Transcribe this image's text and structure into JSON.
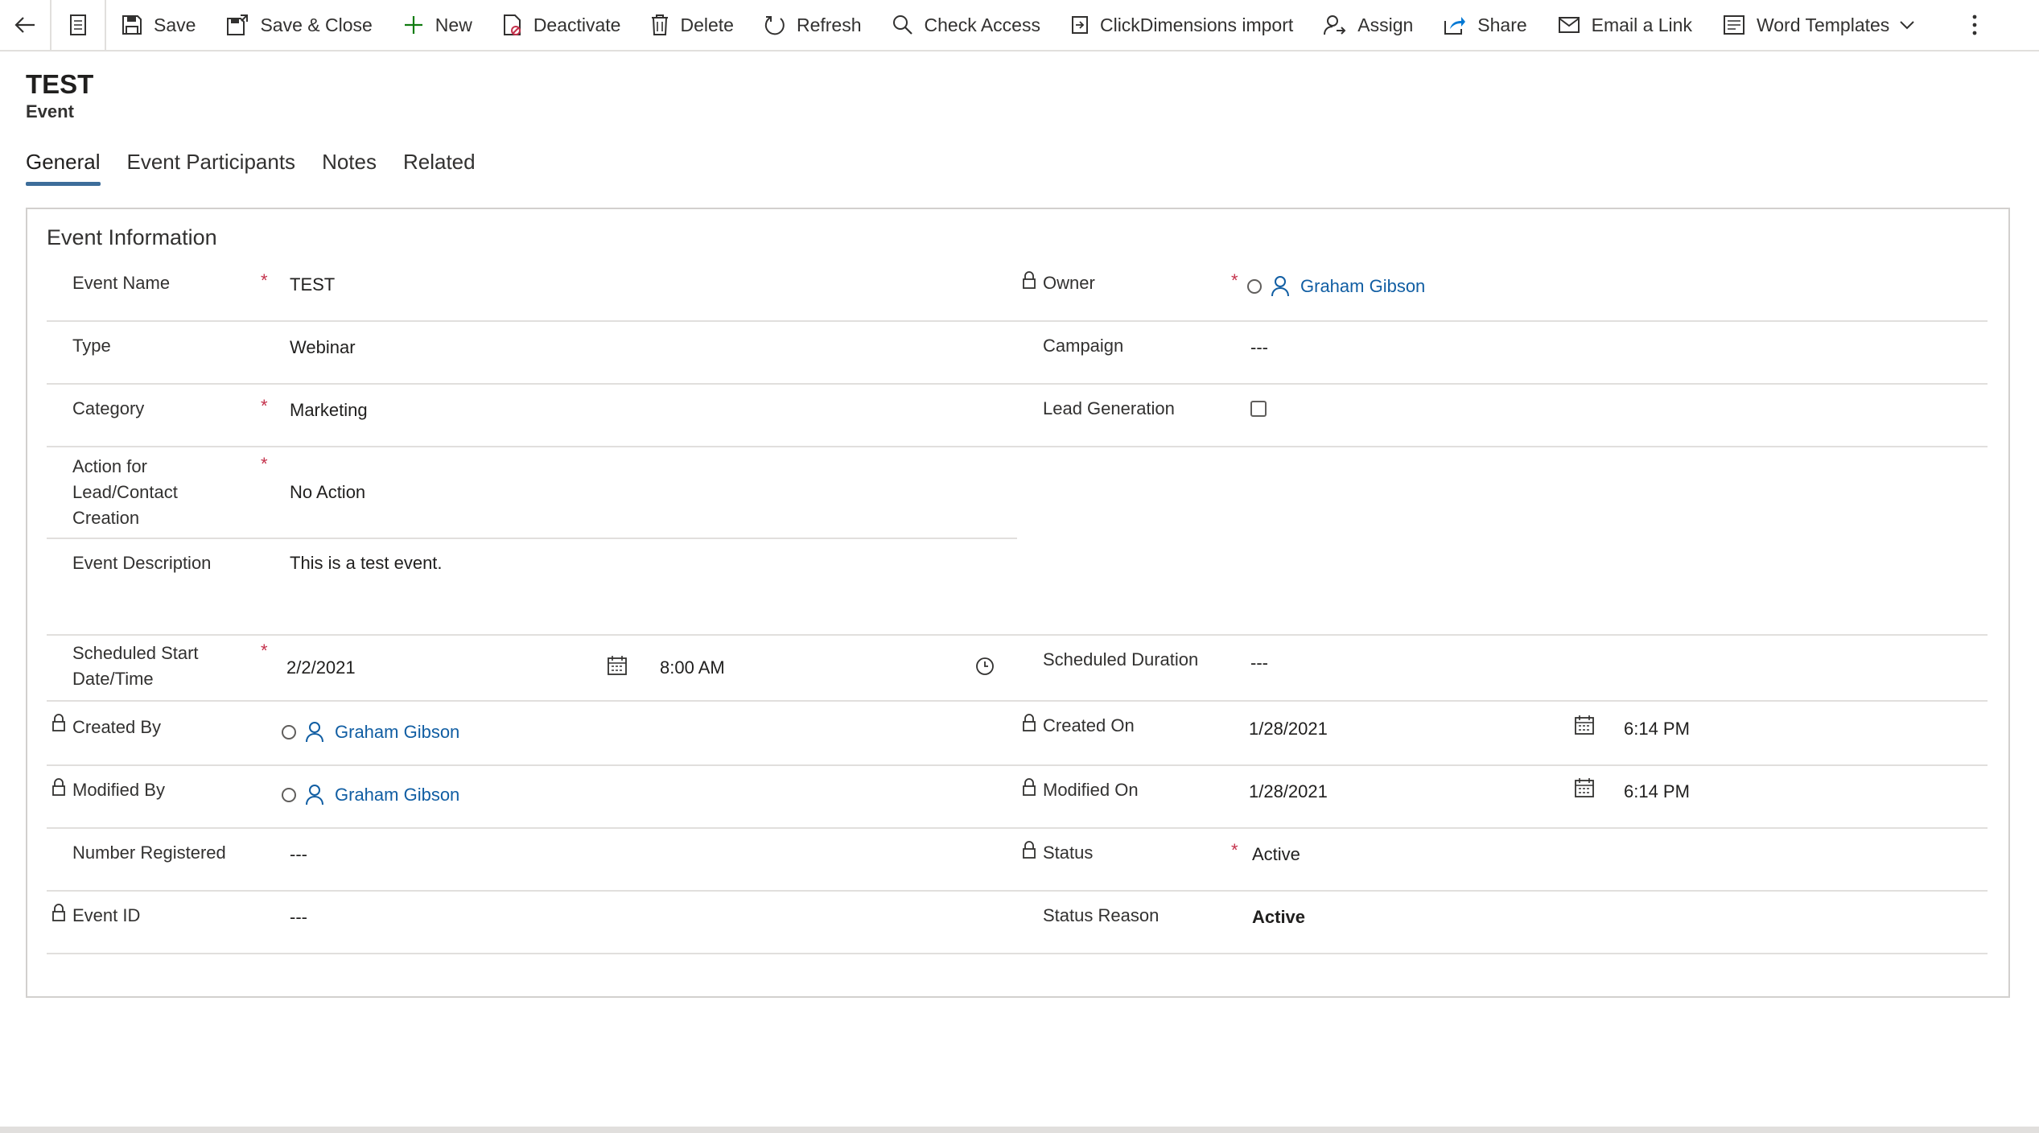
{
  "toolbar": {
    "save": "Save",
    "save_close": "Save & Close",
    "new": "New",
    "deactivate": "Deactivate",
    "delete": "Delete",
    "refresh": "Refresh",
    "check_access": "Check Access",
    "clickdimensions_import": "ClickDimensions import",
    "assign": "Assign",
    "share": "Share",
    "email_link": "Email a Link",
    "word_templates": "Word Templates"
  },
  "header": {
    "title": "TEST",
    "entity": "Event"
  },
  "tabs": [
    "General",
    "Event Participants",
    "Notes",
    "Related"
  ],
  "section": {
    "title": "Event Information"
  },
  "fields": {
    "event_name": {
      "label": "Event Name",
      "value": "TEST"
    },
    "owner": {
      "label": "Owner",
      "value": "Graham Gibson"
    },
    "type": {
      "label": "Type",
      "value": "Webinar"
    },
    "campaign": {
      "label": "Campaign",
      "value": "---"
    },
    "category": {
      "label": "Category",
      "value": "Marketing"
    },
    "lead_generation": {
      "label": "Lead Generation",
      "checked": false
    },
    "action_lead": {
      "label_lines": [
        "Action for",
        "Lead/Contact",
        "Creation"
      ],
      "value": "No Action"
    },
    "event_description": {
      "label": "Event Description",
      "value": "This is a test event."
    },
    "scheduled_start": {
      "label_lines": [
        "Scheduled Start",
        "Date/Time"
      ],
      "date": "2/2/2021",
      "time": "8:00 AM"
    },
    "scheduled_duration": {
      "label": "Scheduled Duration",
      "value": "---"
    },
    "created_by": {
      "label": "Created By",
      "value": "Graham Gibson"
    },
    "created_on": {
      "label": "Created On",
      "date": "1/28/2021",
      "time": "6:14 PM"
    },
    "modified_by": {
      "label": "Modified By",
      "value": "Graham Gibson"
    },
    "modified_on": {
      "label": "Modified On",
      "date": "1/28/2021",
      "time": "6:14 PM"
    },
    "number_registered": {
      "label": "Number Registered",
      "value": "---"
    },
    "status": {
      "label": "Status",
      "value": "Active"
    },
    "event_id": {
      "label": "Event ID",
      "value": "---"
    },
    "status_reason": {
      "label": "Status Reason",
      "value": "Active"
    }
  }
}
